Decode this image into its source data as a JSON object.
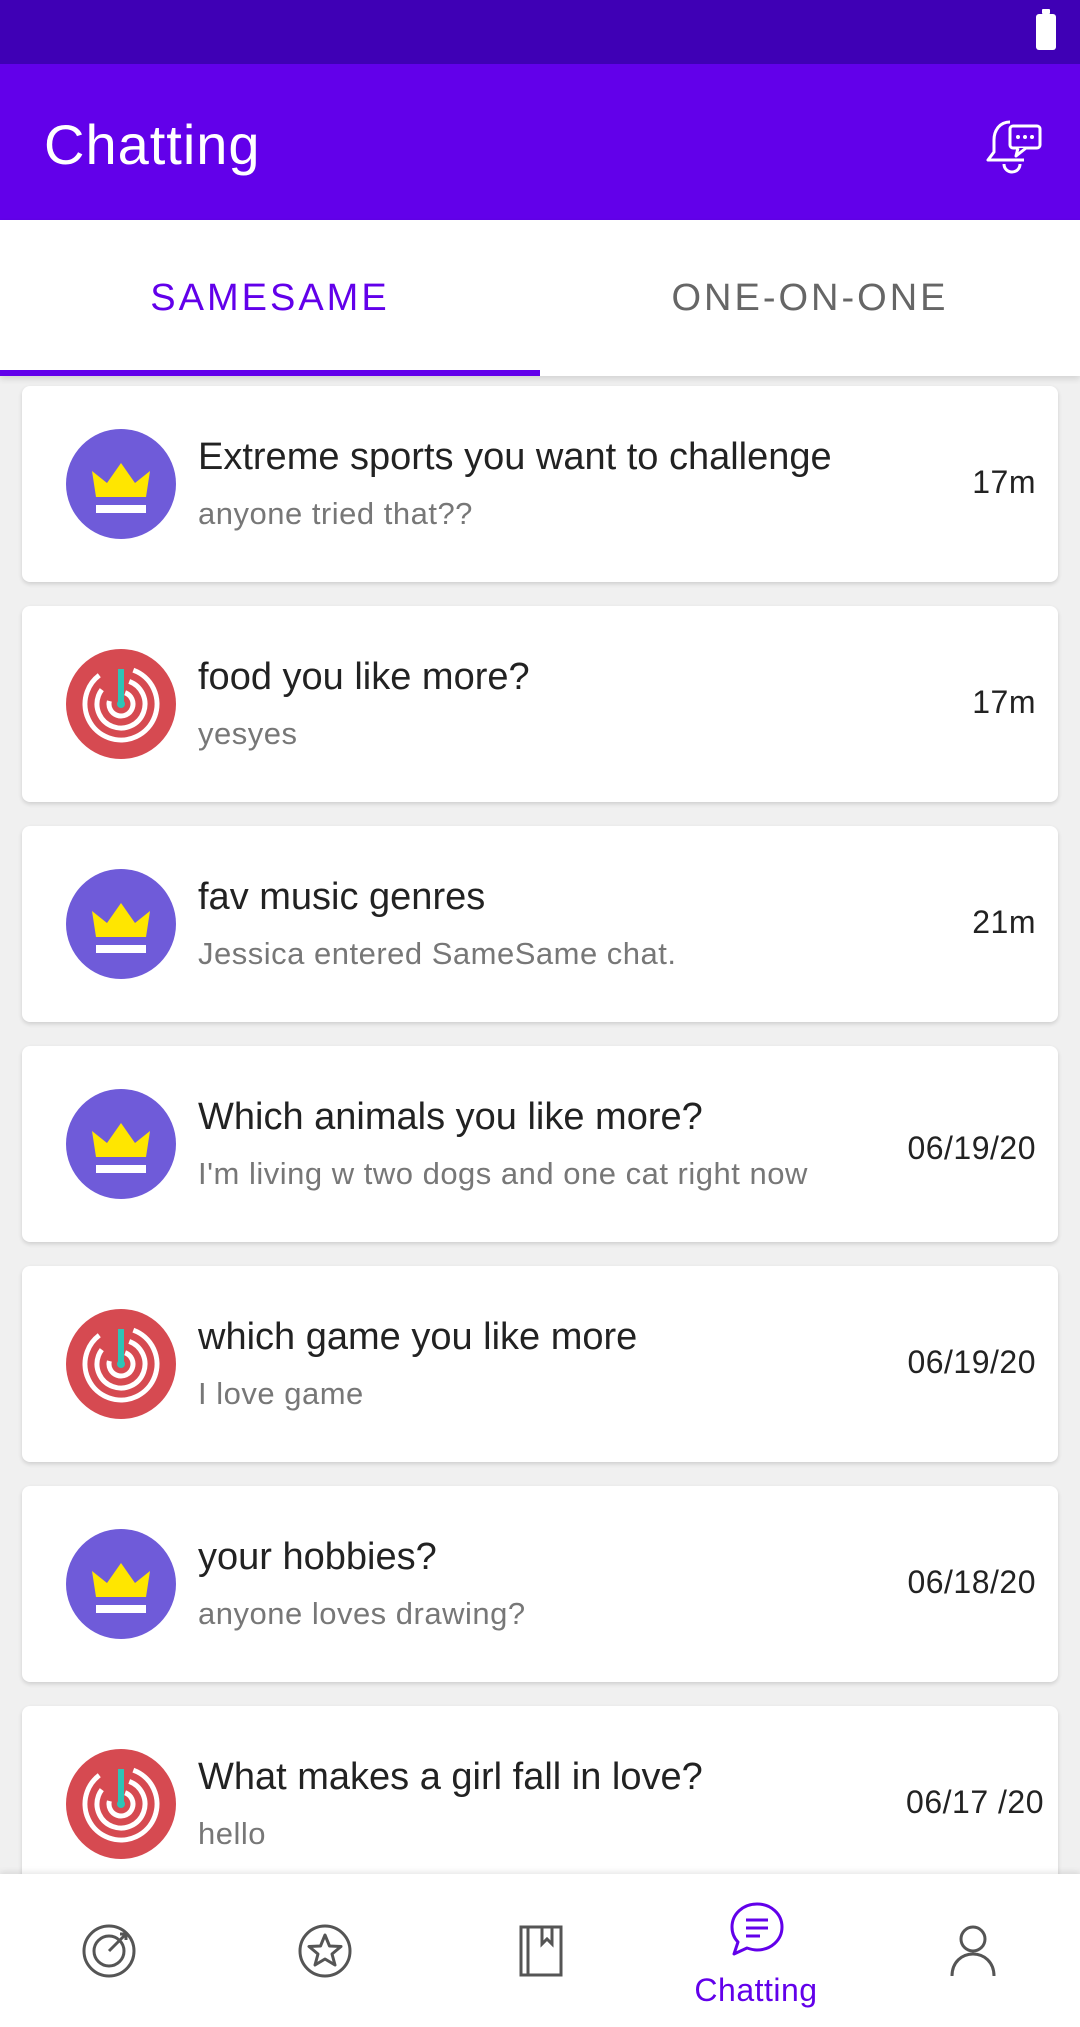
{
  "app": {
    "title": "Chatting",
    "accent": "#6200ea",
    "status_bar_color": "#3f00b5"
  },
  "tabs": [
    {
      "label": "SAMESAME",
      "selected": true
    },
    {
      "label": "ONE-ON-ONE",
      "selected": false
    }
  ],
  "chats": [
    {
      "icon": "crown-icon",
      "title": "Extreme sports you want to challenge",
      "preview": "anyone tried that??",
      "time": "17m"
    },
    {
      "icon": "target-icon",
      "title": "food you like more?",
      "preview": "yesyes",
      "time": "17m"
    },
    {
      "icon": "crown-icon",
      "title": "fav music genres",
      "preview": "Jessica entered SameSame chat.",
      "time": "21m"
    },
    {
      "icon": "crown-icon",
      "title": "Which animals you like more?",
      "preview": "I'm living w two dogs and one cat right now",
      "time": "06/19/20"
    },
    {
      "icon": "target-icon",
      "title": "which game you like more",
      "preview": "I love game",
      "time": "06/19/20"
    },
    {
      "icon": "crown-icon",
      "title": "your hobbies?",
      "preview": "anyone loves drawing?",
      "time": "06/18/20"
    },
    {
      "icon": "target-icon",
      "title": "What makes a girl fall in love?",
      "preview": "hello",
      "time": "06/17 /20"
    }
  ],
  "bottom_nav": {
    "items": [
      {
        "icon": "target-icon",
        "label": ""
      },
      {
        "icon": "star-icon",
        "label": ""
      },
      {
        "icon": "book-icon",
        "label": ""
      },
      {
        "icon": "chat-icon",
        "label": "Chatting",
        "active": true
      },
      {
        "icon": "person-icon",
        "label": ""
      }
    ]
  }
}
